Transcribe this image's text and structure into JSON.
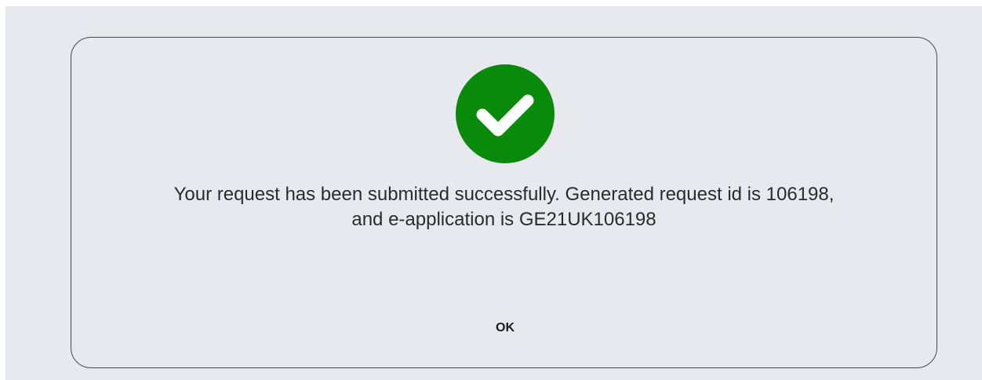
{
  "dialog": {
    "icon": "check-circle-icon",
    "message_line_1": "Your request has been submitted successfully. Generated request id is 106198,",
    "message_line_2": "and e-application is GE21UK106198",
    "ok_label": "OK"
  },
  "colors": {
    "success_green": "#0a8a0a",
    "background": "#e8e9ee",
    "border": "#4a4a4a"
  }
}
